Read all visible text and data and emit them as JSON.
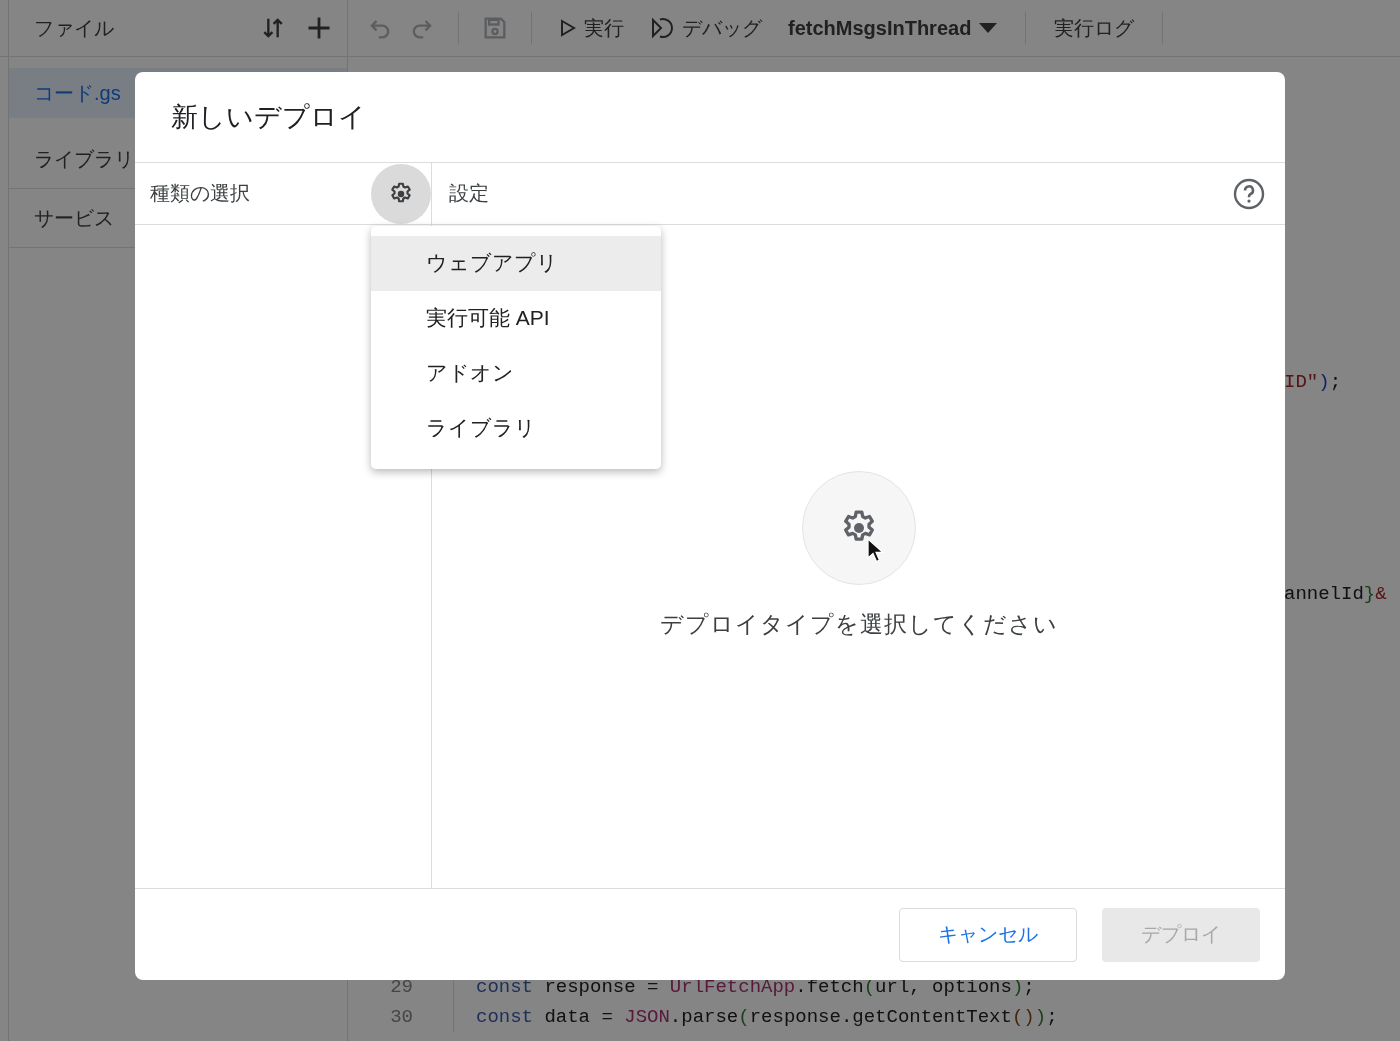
{
  "toolbar": {
    "title": "ファイル",
    "tools": [
      {
        "kind": "sort"
      },
      {
        "kind": "add"
      }
    ],
    "history": [
      {
        "kind": "undo",
        "disabled": true
      },
      {
        "kind": "redo",
        "disabled": true
      },
      {
        "kind": "save",
        "disabled": true
      }
    ],
    "run": "実行",
    "debug": "デバッグ",
    "function": "fetchMsgsInThread",
    "log": "実行ログ"
  },
  "sidebar": {
    "items": [
      {
        "label": "コード.gs",
        "selected": true
      },
      {
        "label": "ライブラリ",
        "selected": false
      },
      {
        "label": "サービス",
        "selected": false
      }
    ]
  },
  "editor": {
    "lines": [
      {
        "tokens": [
          {
            "text": "ID\"",
            "kind": "string"
          },
          {
            "text": ")",
            "kind": "bracket3"
          },
          {
            "text": ";",
            "kind": "plain"
          }
        ]
      },
      {
        "tokens": [
          {
            "text": "annelId",
            "kind": "plain"
          },
          {
            "text": "}",
            "kind": "bracket1"
          },
          {
            "text": "&",
            "kind": "string"
          }
        ]
      },
      {
        "number": "29",
        "tokens": [
          {
            "text": "const",
            "kind": "keyword"
          },
          {
            "text": " response = ",
            "kind": "plain"
          },
          {
            "text": "UrlFetchApp",
            "kind": "global"
          },
          {
            "text": ".fetch",
            "kind": "plain"
          },
          {
            "text": "(",
            "kind": "bracket1"
          },
          {
            "text": "url, options",
            "kind": "plain"
          },
          {
            "text": ")",
            "kind": "bracket1"
          },
          {
            "text": ";",
            "kind": "plain"
          }
        ]
      },
      {
        "number": "30",
        "tokens": [
          {
            "text": "const",
            "kind": "keyword"
          },
          {
            "text": " data = ",
            "kind": "plain"
          },
          {
            "text": "JSON",
            "kind": "global"
          },
          {
            "text": ".parse",
            "kind": "plain"
          },
          {
            "text": "(",
            "kind": "bracket1"
          },
          {
            "text": "response.getContentText",
            "kind": "plain"
          },
          {
            "text": "()",
            "kind": "bracket2"
          },
          {
            "text": ")",
            "kind": "bracket1"
          },
          {
            "text": ";",
            "kind": "plain"
          }
        ]
      }
    ]
  },
  "dialog": {
    "title": "新しいデプロイ",
    "type_header": "種類の選択",
    "settings_header": "設定",
    "type_menu": {
      "items": [
        {
          "label": "ウェブアプリ",
          "selected": true
        },
        {
          "label": "実行可能 API",
          "selected": false
        },
        {
          "label": "アドオン",
          "selected": false
        },
        {
          "label": "ライブラリ",
          "selected": false
        }
      ]
    },
    "empty_state": "デプロイタイプを選択してください",
    "buttons": [
      {
        "label": "キャンセル",
        "kind": "outlined",
        "disabled": false
      },
      {
        "label": "デプロイ",
        "kind": "filled",
        "disabled": true
      }
    ]
  }
}
